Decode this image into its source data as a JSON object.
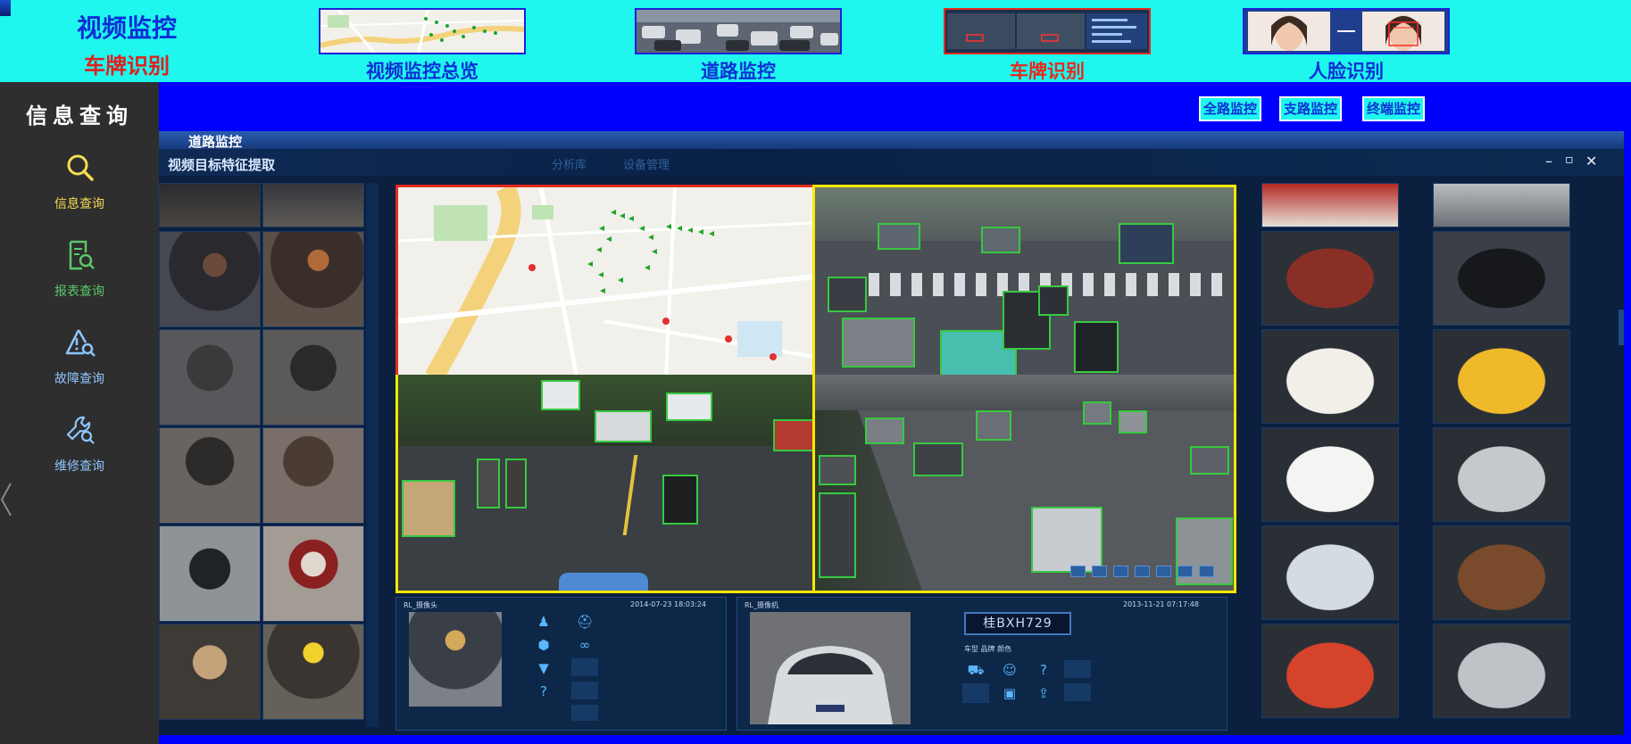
{
  "header": {
    "title": "视频监控",
    "subtitle": "车牌识别",
    "nav": [
      {
        "label": "视频监控总览",
        "thumb": "map-thumbnail",
        "active": false
      },
      {
        "label": "道路监控",
        "thumb": "traffic-thumbnail",
        "active": false
      },
      {
        "label": "车牌识别",
        "thumb": "plate-recognition-thumbnail",
        "active": true
      },
      {
        "label": "人脸识别",
        "thumb": "face-recognition-thumbnail",
        "active": false
      }
    ]
  },
  "sidebar": {
    "title": "信息查询",
    "items": [
      {
        "label": "信息查询",
        "icon": "search-icon",
        "color": "#f5dc52"
      },
      {
        "label": "报表查询",
        "icon": "report-icon",
        "color": "#5bc86a"
      },
      {
        "label": "故障查询",
        "icon": "fault-icon",
        "color": "#8ec6ff"
      },
      {
        "label": "维修查询",
        "icon": "repair-icon",
        "color": "#8ec6ff"
      }
    ]
  },
  "subnav": {
    "buttons": [
      "全路监控",
      "支路监控",
      "终端监控"
    ]
  },
  "panel": {
    "section_title": "道路监控",
    "window_title": "视频目标特征提取",
    "tabs": [
      "分析库",
      "设备管理"
    ],
    "window_controls": [
      "–",
      "▫",
      "✕"
    ]
  },
  "person_card": {
    "label": "RL_摄像头",
    "timestamp": "2014-07-23 18:03:24",
    "icons": [
      "person-icon",
      "hat-icon",
      "shield-icon",
      "glasses-icon",
      "shirt-icon",
      "question-icon"
    ]
  },
  "vehicle_card": {
    "label": "RL_摄像机",
    "timestamp": "2013-11-21 07:17:48",
    "plate": "桂BXH729",
    "attr_text": "车型  品牌  颜色",
    "icons": [
      "car-icon",
      "driver-icon",
      "question-icon",
      "device-icon",
      "upload-icon"
    ]
  },
  "colors": {
    "header_bg": "#1ef6ee",
    "title_blue": "#0d2fd6",
    "accent_red": "#e62a1d",
    "bar_blue": "#0000ff",
    "sidebar_bg": "#2e2e2e",
    "panel_bg": "#0b1f3f",
    "video_border_yellow": "#ffe600",
    "bbox_green": "#37c93f"
  }
}
